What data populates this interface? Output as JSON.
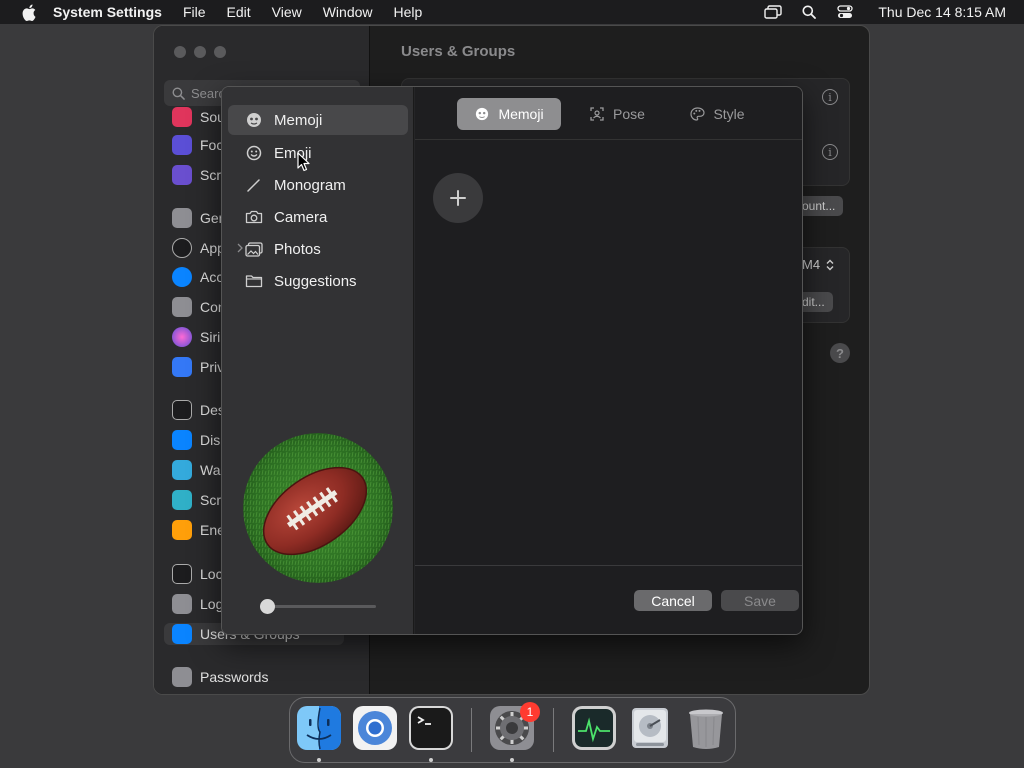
{
  "menubar": {
    "app_name": "System Settings",
    "items": [
      "File",
      "Edit",
      "View",
      "Window",
      "Help"
    ],
    "clock": "Thu Dec 14  8:15 AM"
  },
  "settings": {
    "title": "Users & Groups",
    "search_placeholder": "Search",
    "sidebar_items": [
      {
        "label": "Sound",
        "color": "#e0355c"
      },
      {
        "label": "Focus",
        "color": "#5b4fd6"
      },
      {
        "label": "Screen Time",
        "color": "#6a4fcf"
      },
      {
        "label": "General",
        "color": "#8e8e93"
      },
      {
        "label": "Appearance",
        "color": "#1c1c1e"
      },
      {
        "label": "Accessibility",
        "color": "#0a84ff"
      },
      {
        "label": "Control Center",
        "color": "#8e8e93"
      },
      {
        "label": "Siri & Spotlight",
        "color": "#c23ad8"
      },
      {
        "label": "Privacy & Security",
        "color": "#3478f6"
      },
      {
        "label": "Desktop & Dock",
        "color": "#1c1c1e"
      },
      {
        "label": "Displays",
        "color": "#0a84ff"
      },
      {
        "label": "Wallpaper",
        "color": "#34aadc"
      },
      {
        "label": "Screen Saver",
        "color": "#30b0c7"
      },
      {
        "label": "Energy Saver",
        "color": "#ff9f0a"
      },
      {
        "label": "Lock Screen",
        "color": "#1c1c1e"
      },
      {
        "label": "Login Password",
        "color": "#8e8e93"
      },
      {
        "label": "Users & Groups",
        "color": "#0a84ff"
      },
      {
        "label": "Passwords",
        "color": "#8e8e93"
      }
    ],
    "partial_buttons": [
      "ount...",
      "dit..."
    ],
    "partial_stepper": "M4",
    "help": "?"
  },
  "dialog": {
    "sources": [
      {
        "label": "Memoji",
        "icon": "memoji-icon"
      },
      {
        "label": "Emoji",
        "icon": "emoji-icon"
      },
      {
        "label": "Monogram",
        "icon": "pencil-icon"
      },
      {
        "label": "Camera",
        "icon": "camera-icon"
      },
      {
        "label": "Photos",
        "icon": "photos-icon"
      },
      {
        "label": "Suggestions",
        "icon": "folder-icon"
      }
    ],
    "selected_source": "Memoji",
    "tabs": [
      {
        "label": "Memoji",
        "icon": "memoji-icon"
      },
      {
        "label": "Pose",
        "icon": "pose-icon"
      },
      {
        "label": "Style",
        "icon": "palette-icon"
      }
    ],
    "active_tab": "Memoji",
    "add_symbol": "+",
    "zoom_level": 0,
    "cancel_label": "Cancel",
    "save_label": "Save"
  },
  "dock": {
    "apps": [
      {
        "name": "Finder",
        "running": true
      },
      {
        "name": "Chromium",
        "running": false
      },
      {
        "name": "Terminal",
        "running": true
      },
      {
        "name": "System Settings",
        "running": true,
        "badge": "1"
      },
      {
        "name": "Activity Monitor",
        "running": false
      },
      {
        "name": "Disk Utility",
        "running": false
      },
      {
        "name": "Trash",
        "running": false
      }
    ]
  }
}
